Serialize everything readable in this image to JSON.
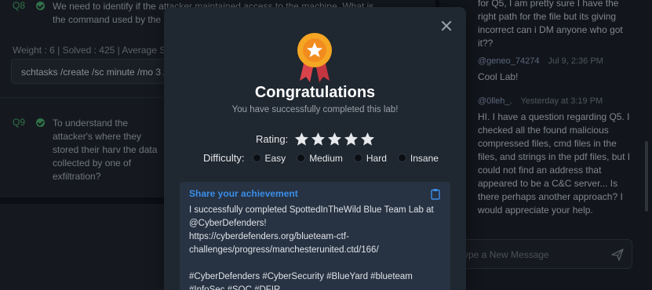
{
  "background": {
    "q8": {
      "number": "Q8",
      "text": "We need to identify if the attacker maintained access to the machine. What is the command used by the a",
      "meta": "Weight : 6 | Solved : 425 | Average Sol",
      "answer": "schtasks /create /sc minute /mo 3 /t"
    },
    "q9": {
      "number": "Q9",
      "text": "To understand the attacker's where they stored their harv the data collected by one of exfiltration?"
    }
  },
  "chat": {
    "messages": [
      {
        "user": "",
        "time": "",
        "body": "for Q5, I am pretty sure I have the right path for the file but its giving incorrect can i DM anyone who got it??"
      },
      {
        "user": "@geneo_74274",
        "time": "Jul 9, 2:36 PM",
        "body": "Cool Lab!"
      },
      {
        "user": "@0lleh_.",
        "time": "Yesterday at 3:19 PM",
        "body": "HI. I have a question regarding Q5. I checked all the found malicious compressed files, cmd files in the files, and strings in the pdf files, but I could not find an address that appeared to be a C&C server... Is there perhaps another approach? I would appreciate your help."
      }
    ],
    "input_placeholder": "ype a New Message"
  },
  "modal": {
    "title": "Congratulations",
    "subtitle": "You have successfully completed this lab!",
    "rating_label": "Rating:",
    "rating_value": 5,
    "rating_max": 5,
    "difficulty_label": "Difficulty:",
    "difficulty_options": [
      "Easy",
      "Medium",
      "Hard",
      "Insane"
    ],
    "share_title": "Share your achievement",
    "share_text": "I successfully completed SpottedInTheWild Blue Team Lab at @CyberDefenders!\nhttps://cyberdefenders.org/blueteam-ctf-challenges/progress/manchesterunited.ctd/166/\n\n#CyberDefenders #CyberSecurity #BlueYard #blueteam #InfoSec #SOC #DFIR"
  },
  "colors": {
    "accent": "#3b8ee8",
    "success": "#3c8a58",
    "medal_gold": "#f5a623",
    "ribbon": "#d9434b"
  }
}
